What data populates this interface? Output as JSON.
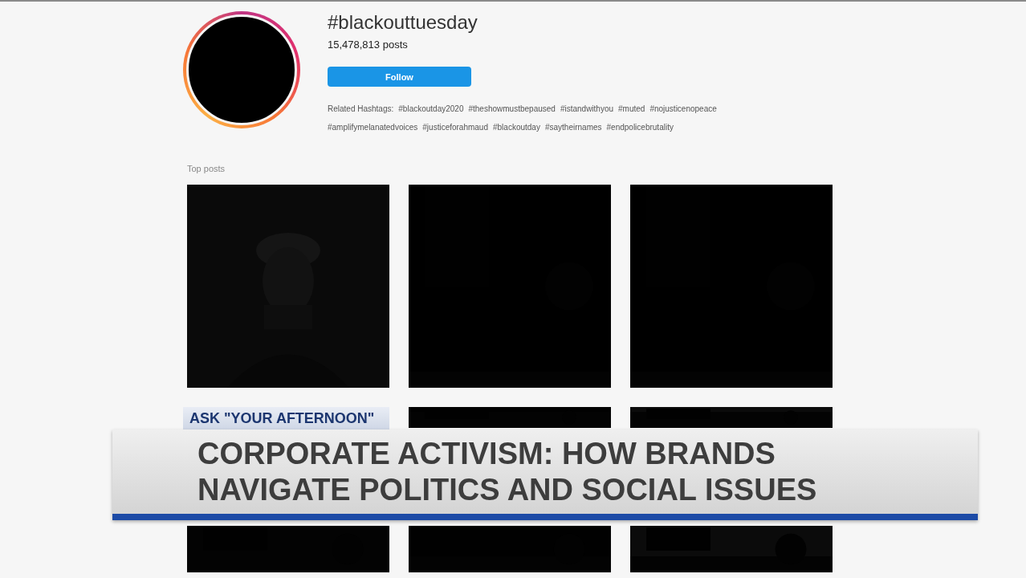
{
  "profile": {
    "hashtag": "#blackouttuesday",
    "posts_count": "15,478,813 posts",
    "follow_button": "Follow",
    "related_label": "Related Hashtags:",
    "related_hashtags": [
      "#blackoutday2020",
      "#theshowmustbepaused",
      "#istandwithyou",
      "#muted",
      "#nojusticenopeace",
      "#amplifymelanatedvoices",
      "#justiceforahmaud",
      "#blackoutday",
      "#saytheirnames",
      "#endpolicebrutality"
    ]
  },
  "top_posts": {
    "heading": "Top posts"
  },
  "lower_third": {
    "tag": "ASK \"YOUR AFTERNOON\"",
    "headline_lines": [
      "CORPORATE ACTIVISM: HOW BRANDS",
      "NAVIGATE POLITICS AND SOCIAL ISSUES"
    ]
  }
}
